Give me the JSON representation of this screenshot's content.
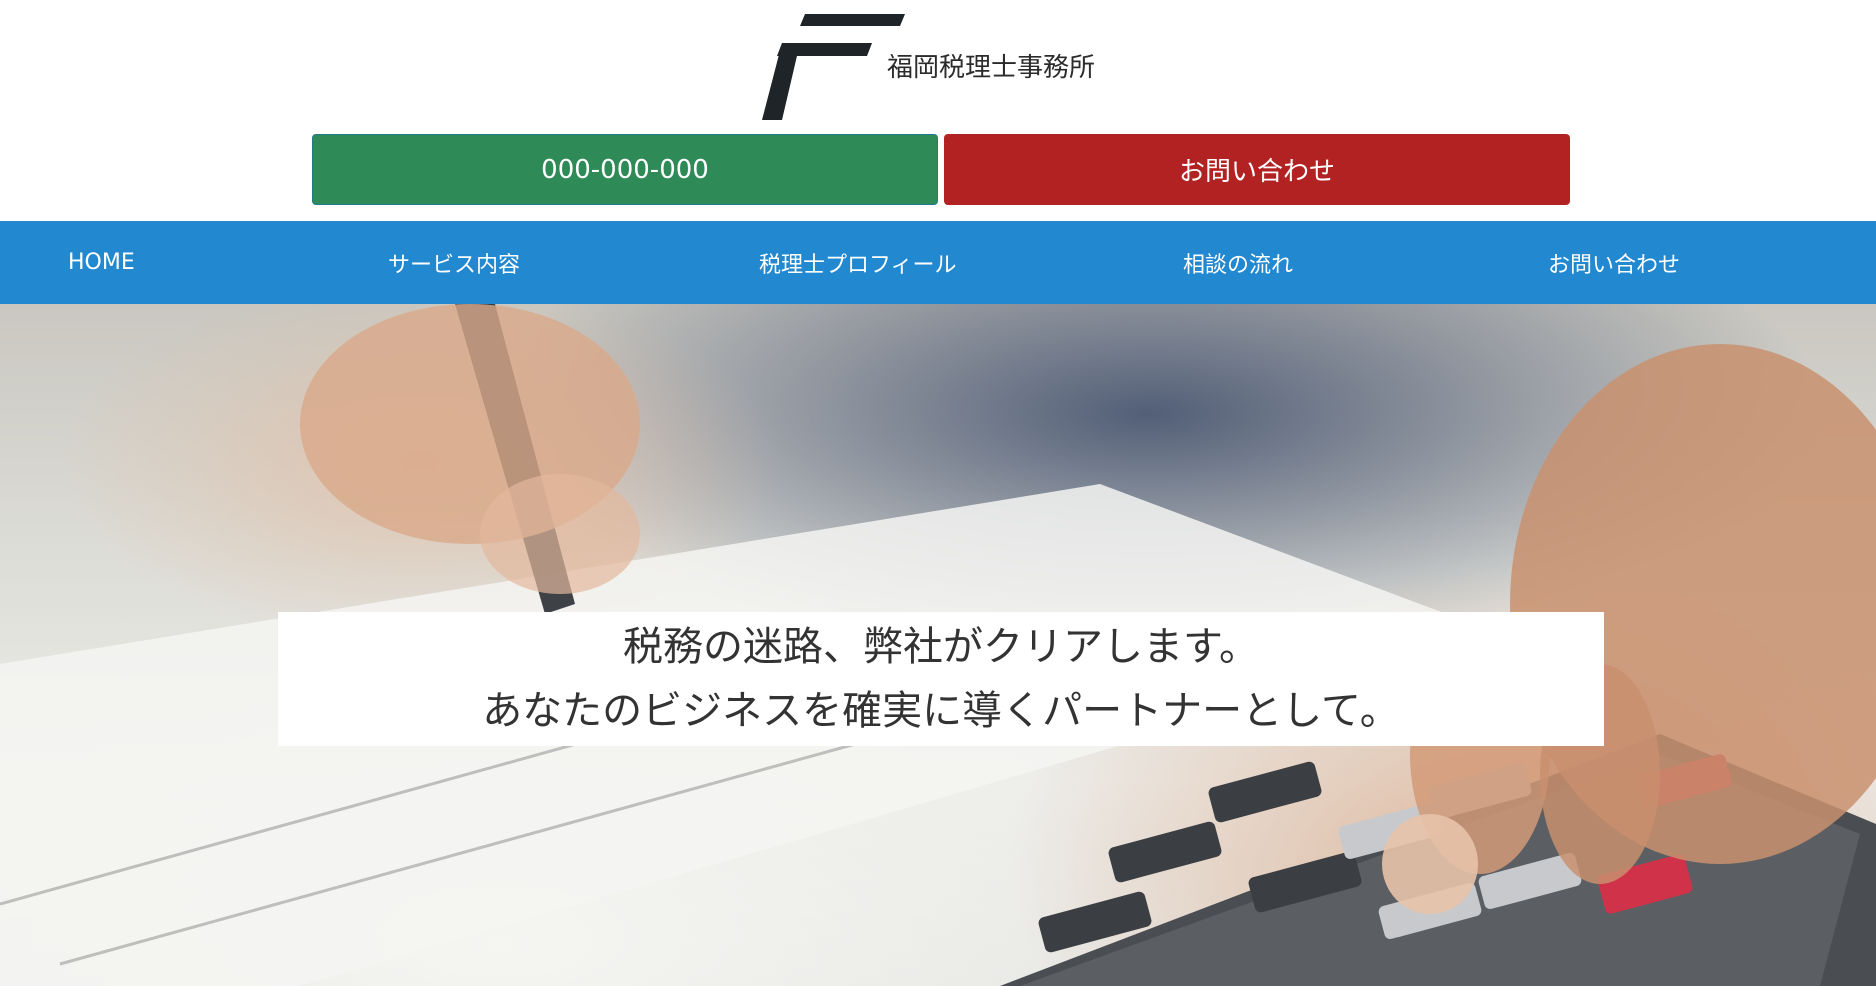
{
  "header": {
    "logo_text": "福岡税理士事務所",
    "logo_icon": "f-logo-mark",
    "phone_label": "000-000-000",
    "contact_label": "お問い合わせ",
    "colors": {
      "phone_button": "#2e8b57",
      "contact_button": "#b22222"
    }
  },
  "nav": {
    "color": "#2288d0",
    "items": [
      {
        "label": "HOME"
      },
      {
        "label": "サービス内容"
      },
      {
        "label": "税理士プロフィール"
      },
      {
        "label": "相談の流れ"
      },
      {
        "label": "お問い合わせ"
      }
    ]
  },
  "hero": {
    "tagline_line1": "税務の迷路、弊社がクリアします。",
    "tagline_line2": "あなたのビジネスを確実に導くパートナーとして。"
  }
}
